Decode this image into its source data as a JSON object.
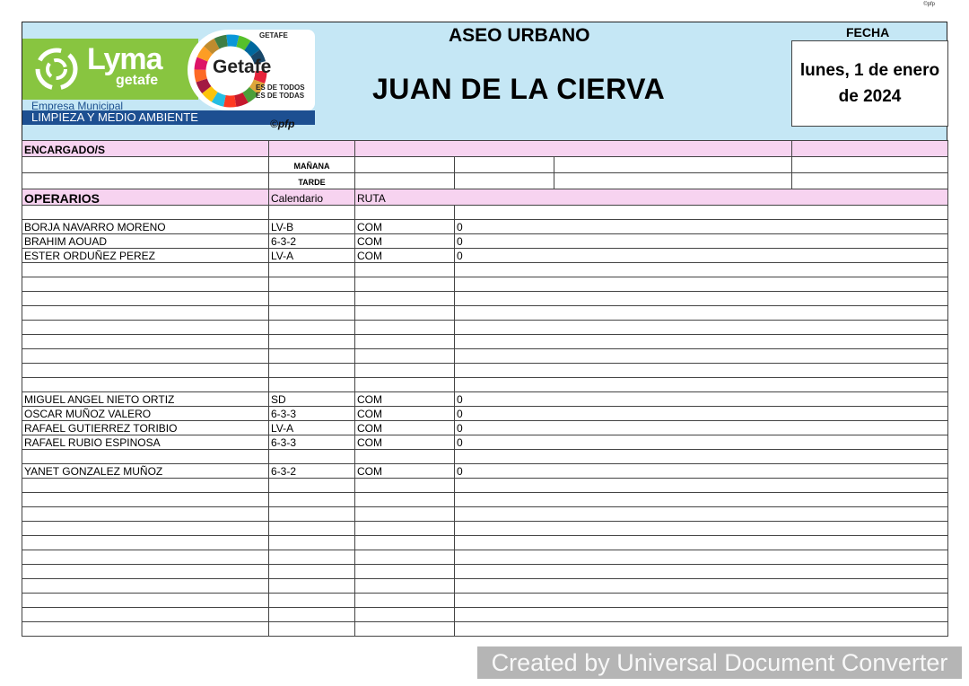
{
  "corner_mark": "©pfp",
  "logos": {
    "lyma_main": "Lyma",
    "lyma_sub": "getafe",
    "empresa": "Empresa Municipal",
    "limpieza": "LIMPIEZA Y MEDIO AMBIENTE",
    "pfp": "©pfp",
    "getafe": "Getafe",
    "ayuntamiento": "GETAFE",
    "es_todos_1": "ES DE TODOS",
    "es_todos_2": "ES DE TODAS"
  },
  "header": {
    "service": "ASEO URBANO",
    "zone": "JUAN DE LA CIERVA",
    "fecha_label": "FECHA",
    "fecha_value": "lunes, 1 de enero de 2024"
  },
  "encargados": {
    "label": "ENCARGADO/S",
    "manana": "MAÑANA",
    "tarde": "TARDE"
  },
  "operarios": {
    "label": "OPERARIOS",
    "col_calendario": "Calendario",
    "col_ruta": "RUTA",
    "rows": [
      {
        "name": "",
        "cal": "",
        "ruta": "",
        "val": ""
      },
      {
        "name": "BORJA NAVARRO MORENO",
        "cal": "LV-B",
        "ruta": "COM",
        "val": "0"
      },
      {
        "name": "BRAHIM AOUAD",
        "cal": "6-3-2",
        "ruta": "COM",
        "val": "0"
      },
      {
        "name": "ESTER ORDUÑEZ PEREZ",
        "cal": "LV-A",
        "ruta": "COM",
        "val": "0"
      },
      {
        "name": "",
        "cal": "",
        "ruta": "",
        "val": ""
      },
      {
        "name": "",
        "cal": "",
        "ruta": "",
        "val": ""
      },
      {
        "name": "",
        "cal": "",
        "ruta": "",
        "val": ""
      },
      {
        "name": "",
        "cal": "",
        "ruta": "",
        "val": ""
      },
      {
        "name": "",
        "cal": "",
        "ruta": "",
        "val": ""
      },
      {
        "name": "",
        "cal": "",
        "ruta": "",
        "val": ""
      },
      {
        "name": "",
        "cal": "",
        "ruta": "",
        "val": ""
      },
      {
        "name": "",
        "cal": "",
        "ruta": "",
        "val": ""
      },
      {
        "name": "",
        "cal": "",
        "ruta": "",
        "val": ""
      },
      {
        "name": "MIGUEL ANGEL NIETO ORTIZ",
        "cal": "SD",
        "ruta": "COM",
        "val": "0"
      },
      {
        "name": "OSCAR MUÑOZ VALERO",
        "cal": "6-3-3",
        "ruta": "COM",
        "val": "0"
      },
      {
        "name": "RAFAEL GUTIERREZ TORIBIO",
        "cal": "LV-A",
        "ruta": "COM",
        "val": "0"
      },
      {
        "name": "RAFAEL RUBIO ESPINOSA",
        "cal": "6-3-3",
        "ruta": "COM",
        "val": "0"
      },
      {
        "name": "",
        "cal": "",
        "ruta": "",
        "val": ""
      },
      {
        "name": "YANET GONZALEZ MUÑOZ",
        "cal": "6-3-2",
        "ruta": "COM",
        "val": "0"
      },
      {
        "name": "",
        "cal": "",
        "ruta": "",
        "val": ""
      },
      {
        "name": "",
        "cal": "",
        "ruta": "",
        "val": ""
      },
      {
        "name": "",
        "cal": "",
        "ruta": "",
        "val": ""
      },
      {
        "name": "",
        "cal": "",
        "ruta": "",
        "val": ""
      },
      {
        "name": "",
        "cal": "",
        "ruta": "",
        "val": ""
      },
      {
        "name": "",
        "cal": "",
        "ruta": "",
        "val": ""
      },
      {
        "name": "",
        "cal": "",
        "ruta": "",
        "val": ""
      },
      {
        "name": "",
        "cal": "",
        "ruta": "",
        "val": ""
      },
      {
        "name": "",
        "cal": "",
        "ruta": "",
        "val": ""
      },
      {
        "name": "",
        "cal": "",
        "ruta": "",
        "val": ""
      },
      {
        "name": "",
        "cal": "",
        "ruta": "",
        "val": ""
      }
    ]
  },
  "watermark": "Created by Universal Document Converter",
  "colors": {
    "header_bg": "#c5e7f5",
    "pink_row": "#f7d3f0",
    "lyma_green": "#88c540",
    "navy": "#1d4f91"
  }
}
